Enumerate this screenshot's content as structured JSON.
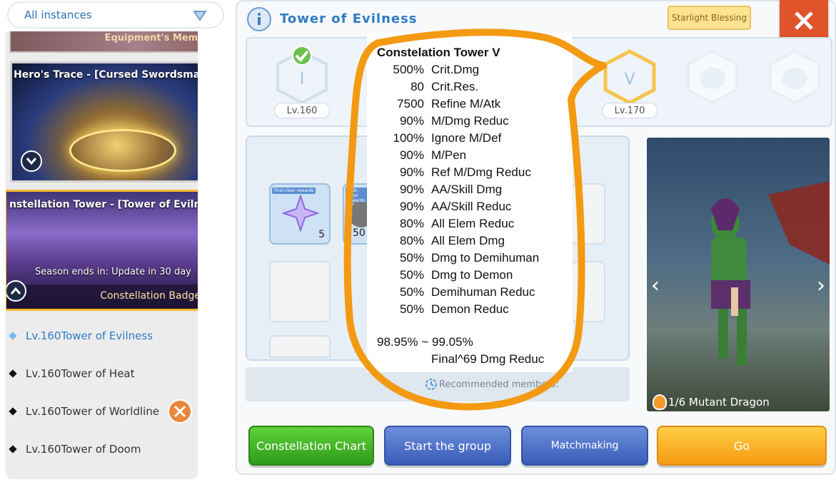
{
  "sidebar": {
    "dropdown_label": "All instances",
    "equipment_card_label": "Equipment's Memory",
    "hero_card_title": "Hero's Trace - [Cursed Swordsman]",
    "const_card_title": "nstellation Tower - [Tower of Evilne",
    "season_text": "Season ends in: Update in 30 day",
    "badge_label": "Constellation Badge",
    "towers": [
      {
        "label": "Lv.160Tower of Evilness"
      },
      {
        "label": "Lv.160Tower of Heat"
      },
      {
        "label": "Lv.160Tower of Worldline"
      },
      {
        "label": "Lv.160Tower of Doom"
      }
    ]
  },
  "header": {
    "title": "Tower of Evilness",
    "starlight_label": "Starlight Blessing",
    "close_icon": "close-icon"
  },
  "levels": [
    {
      "roman": "I",
      "label": "Lv.160"
    },
    {
      "roman": "V",
      "label": "Lv.170"
    }
  ],
  "rewards": {
    "first_clear_tag": "First-clear rewards",
    "item1_qty": "5",
    "item2_qty": "50"
  },
  "recommended": "Recommended members:",
  "monster": {
    "name": "1/6 Mutant Dragon"
  },
  "buttons": {
    "chart": "Constellation Chart",
    "group": "Start the group",
    "match": "Matchmaking",
    "go": "Go"
  },
  "tooltip": {
    "title": "Constelation Tower V",
    "stats": [
      {
        "value": "500%",
        "name": "Crit.Dmg"
      },
      {
        "value": "80",
        "name": "Crit.Res."
      },
      {
        "value": "7500",
        "name": "Refine M/Atk"
      },
      {
        "value": "90%",
        "name": "M/Dmg Reduc"
      },
      {
        "value": "100%",
        "name": "Ignore M/Def"
      },
      {
        "value": "90%",
        "name": "M/Pen"
      },
      {
        "value": "90%",
        "name": "Ref M/Dmg Reduc"
      },
      {
        "value": "90%",
        "name": "AA/Skill Dmg"
      },
      {
        "value": "90%",
        "name": "AA/Skill Reduc"
      },
      {
        "value": "80%",
        "name": "All Elem Reduc"
      },
      {
        "value": "80%",
        "name": "All Elem Dmg"
      },
      {
        "value": "50%",
        "name": "Dmg to Demihuman"
      },
      {
        "value": "50%",
        "name": "Dmg to Demon"
      },
      {
        "value": "50%",
        "name": "Demihuman Reduc"
      },
      {
        "value": "50%",
        "name": "Demon Reduc"
      }
    ],
    "range": "98.95% ~ 99.05%",
    "final": "Final^69 Dmg Reduc"
  },
  "colors": {
    "accent_blue": "#2e7bc4",
    "annotation_orange": "#f39a12",
    "close_red": "#e0542b"
  }
}
